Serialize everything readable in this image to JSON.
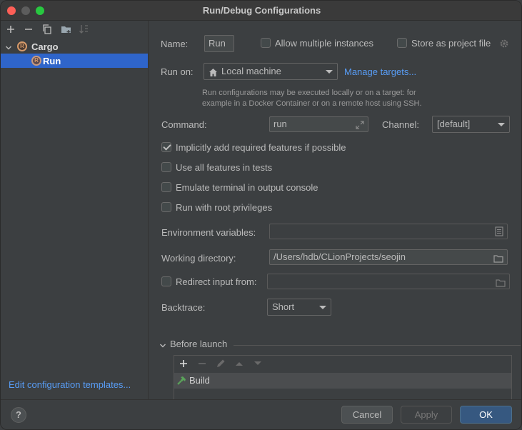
{
  "window": {
    "title": "Run/Debug Configurations"
  },
  "tree": {
    "cargo_label": "Cargo",
    "run_label": "Run",
    "edit_templates": "Edit configuration templates..."
  },
  "form": {
    "name_label": "Name:",
    "name_value": "Run",
    "allow_multiple": "Allow multiple instances",
    "store_project": "Store as project file",
    "run_on_label": "Run on:",
    "run_on_value": "Local machine",
    "manage_targets": "Manage targets...",
    "hint_line1": "Run configurations may be executed locally or on a target: for",
    "hint_line2": "example in a Docker Container or on a remote host using SSH.",
    "command_label": "Command:",
    "command_value": "run",
    "channel_label": "Channel:",
    "channel_value": "[default]",
    "opt_features": "Implicitly add required features if possible",
    "opt_all_features": "Use all features in tests",
    "opt_emulate": "Emulate terminal in output console",
    "opt_root": "Run with root privileges",
    "env_label": "Environment variables:",
    "env_value": "",
    "workdir_label": "Working directory:",
    "workdir_value": "/Users/hdb/CLionProjects/seojin",
    "redirect_label": "Redirect input from:",
    "redirect_value": "",
    "backtrace_label": "Backtrace:",
    "backtrace_value": "Short",
    "before_launch": "Before launch",
    "build_item": "Build"
  },
  "state": {
    "features_checked": true,
    "all_features_checked": false,
    "emulate_checked": false,
    "root_checked": false,
    "allow_multiple_checked": false,
    "store_project_checked": false,
    "redirect_checked": false
  },
  "buttons": {
    "help": "?",
    "cancel": "Cancel",
    "apply": "Apply",
    "ok": "OK"
  },
  "colors": {
    "accent": "#2f65ca",
    "link": "#589df6",
    "ok_button": "#365880"
  }
}
